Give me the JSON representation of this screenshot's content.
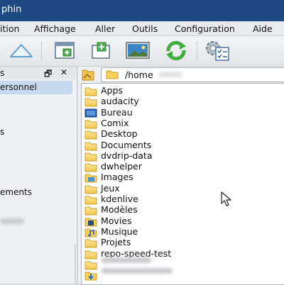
{
  "window": {
    "title": "phin"
  },
  "menu": [
    "ition",
    "Affichage",
    "Aller",
    "Outils",
    "Configuration",
    "Aide"
  ],
  "toolbar": {
    "items": [
      {
        "icon": "up-arrow-icon"
      },
      {
        "icon": "new-window-icon"
      },
      {
        "icon": "new-tab-icon"
      },
      {
        "icon": "preview-image-icon"
      },
      {
        "icon": "refresh-icon"
      },
      {
        "icon": "settings-icon"
      }
    ]
  },
  "places": {
    "header": "s",
    "items": [
      {
        "label": "ersonnel",
        "selected": true
      },
      {
        "label": "s"
      },
      {
        "label": "ements"
      }
    ]
  },
  "location": {
    "path": "/home"
  },
  "files": [
    {
      "name": "Apps",
      "icon": "folder-icon"
    },
    {
      "name": "audacity",
      "icon": "folder-icon"
    },
    {
      "name": "Bureau",
      "icon": "desktop-folder-icon"
    },
    {
      "name": "Comix",
      "icon": "folder-icon"
    },
    {
      "name": "Desktop",
      "icon": "folder-icon"
    },
    {
      "name": "Documents",
      "icon": "folder-icon"
    },
    {
      "name": "dvdrip-data",
      "icon": "folder-icon"
    },
    {
      "name": "dwhelper",
      "icon": "folder-icon"
    },
    {
      "name": "Images",
      "icon": "pictures-folder-icon"
    },
    {
      "name": "Jeux",
      "icon": "folder-icon"
    },
    {
      "name": "kdenlive",
      "icon": "folder-icon"
    },
    {
      "name": "Modèles",
      "icon": "folder-icon"
    },
    {
      "name": "Movies",
      "icon": "movies-folder-icon"
    },
    {
      "name": "Musique",
      "icon": "music-folder-icon"
    },
    {
      "name": "Projets",
      "icon": "folder-icon"
    },
    {
      "name": "repo-speed-test",
      "icon": "folder-icon"
    },
    {
      "name": "",
      "icon": "folder-icon"
    },
    {
      "name": "",
      "icon": "download-folder-icon"
    }
  ]
}
